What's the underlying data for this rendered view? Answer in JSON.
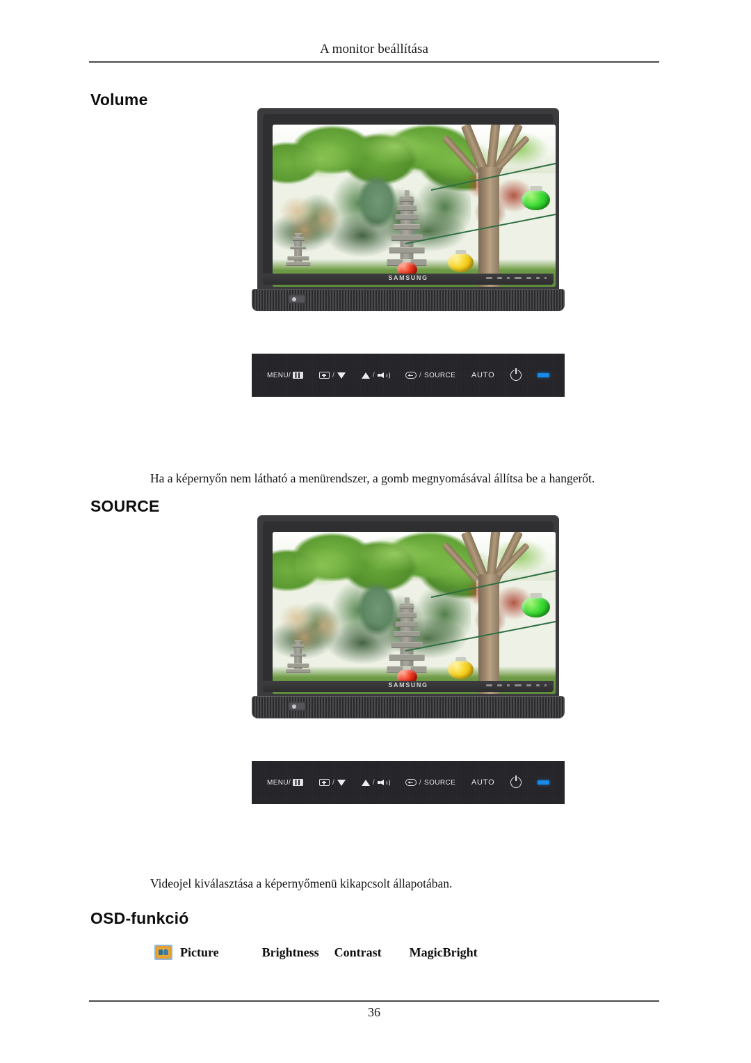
{
  "header": {
    "running_head": "A monitor beállítása"
  },
  "sections": [
    {
      "heading": "Volume",
      "caption": "Ha a képernyőn nem látható a menürendszer, a gomb megnyomásával állítsa be a hangerőt."
    },
    {
      "heading": "SOURCE",
      "caption": "Videojel kiválasztása a képernyőmenü kikapcsolt állapotában."
    },
    {
      "heading": "OSD-funkció"
    }
  ],
  "monitor": {
    "brand": "SAMSUNG",
    "screen_content": "garden scene with stone pagoda, trees and paper lanterns"
  },
  "control_panel": {
    "buttons": [
      {
        "id": "menu",
        "label": "MENU/",
        "icon": "menu-bars-icon"
      },
      {
        "id": "down",
        "label": "/",
        "icon_left": "box-plus-icon",
        "icon_right": "triangle-down-icon"
      },
      {
        "id": "up-volume",
        "label": "/",
        "icon_left": "triangle-up-icon",
        "icon_right": "speaker-volume-icon"
      },
      {
        "id": "source",
        "label": "SOURCE",
        "separator": "/",
        "icon": "enter-icon"
      },
      {
        "id": "auto",
        "label": "AUTO"
      },
      {
        "id": "power",
        "icon": "power-icon"
      },
      {
        "id": "led",
        "icon": "power-led-indicator"
      }
    ],
    "led_color": "#1a8ae8",
    "panel_color": "#242428"
  },
  "osd": {
    "icon": "picture-osd-icon",
    "items": [
      "Picture",
      "Brightness",
      "Contrast",
      "MagicBright"
    ]
  },
  "footer": {
    "page_number": "36"
  }
}
